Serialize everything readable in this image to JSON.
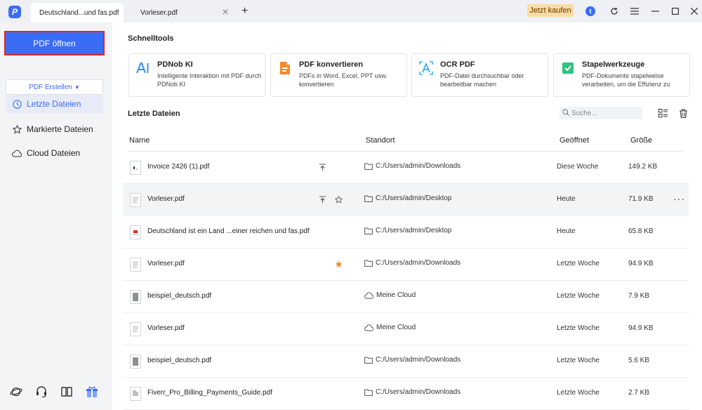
{
  "tabs": [
    {
      "title": "Deutschland...und fas.pdf",
      "active": true
    },
    {
      "title": "Vorleser.pdf",
      "active": false
    }
  ],
  "titlebar": {
    "buy_label": "Jetzt kaufen"
  },
  "sidebar": {
    "open_label": "PDF öffnen",
    "create_label": "PDF Erstellen",
    "nav": [
      {
        "label": "Letzte Dateien",
        "icon": "clock-icon",
        "active": true
      },
      {
        "label": "Markierte Dateien",
        "icon": "star-icon",
        "active": false
      },
      {
        "label": "Cloud Dateien",
        "icon": "cloud-icon",
        "active": false
      }
    ],
    "bottom_icons": [
      "planet-icon",
      "headset-icon",
      "book-icon",
      "gift-icon"
    ]
  },
  "quicktools": {
    "title": "Schnelltools",
    "cards": [
      {
        "title": "PDNob KI",
        "desc": "Intelligente Interaktion mit PDF durch PDNob KI",
        "icon": "ai-icon"
      },
      {
        "title": "PDF konvertieren",
        "desc": "PDFs in Word, Excel, PPT usw. konvertieren",
        "icon": "convert-icon"
      },
      {
        "title": "OCR PDF",
        "desc": "PDF-Datei durchsuchbar oder bearbeitbar machen",
        "icon": "ocr-icon"
      },
      {
        "title": "Stapelwerkzeuge",
        "desc": "PDF-Dokumente stapelweise verarbeiten, um die Effizienz zu",
        "icon": "batch-icon"
      }
    ]
  },
  "recent": {
    "title": "Letzte Dateien",
    "search_placeholder": "Suche...",
    "columns": {
      "name": "Name",
      "location": "Standort",
      "opened": "Geöffnet",
      "size": "Größe"
    },
    "files": [
      {
        "name": "Invoice 2426 (1).pdf",
        "location": "C:/Users/admin/Downloads",
        "loc_type": "folder",
        "opened": "Diese Woche",
        "size": "149.2 KB",
        "pinned": true,
        "starred": false,
        "hover": false
      },
      {
        "name": "Vorleser.pdf",
        "location": "C:/Users/admin/Desktop",
        "loc_type": "folder",
        "opened": "Heute",
        "size": "71.9 KB",
        "pinned": true,
        "starred": false,
        "hover": true
      },
      {
        "name": "Deutschland ist ein Land ...einer reichen und fas.pdf",
        "location": "C:/Users/admin/Desktop",
        "loc_type": "folder",
        "opened": "Heute",
        "size": "65.8 KB",
        "pinned": false,
        "starred": false,
        "hover": false
      },
      {
        "name": "Vorleser.pdf",
        "location": "C:/Users/admin/Downloads",
        "loc_type": "folder",
        "opened": "Letzte Woche",
        "size": "94.9 KB",
        "pinned": false,
        "starred": true,
        "hover": false
      },
      {
        "name": "beispiel_deutsch.pdf",
        "location": "Meine Cloud",
        "loc_type": "cloud",
        "opened": "Letzte Woche",
        "size": "7.9 KB",
        "pinned": false,
        "starred": false,
        "hover": false
      },
      {
        "name": "Vorleser.pdf",
        "location": "Meine Cloud",
        "loc_type": "cloud",
        "opened": "Letzte Woche",
        "size": "94.9 KB",
        "pinned": false,
        "starred": false,
        "hover": false
      },
      {
        "name": "beispiel_deutsch.pdf",
        "location": "C:/Users/admin/Downloads",
        "loc_type": "folder",
        "opened": "Letzte Woche",
        "size": "5.6 KB",
        "pinned": false,
        "starred": false,
        "hover": false
      },
      {
        "name": "Fiverr_Pro_Billing_Payments_Guide.pdf",
        "location": "C:/Users/admin/Downloads",
        "loc_type": "folder",
        "opened": "Letzte Woche",
        "size": "2.7 KB",
        "pinned": false,
        "starred": false,
        "hover": false
      }
    ]
  },
  "colors": {
    "accent": "#3b6cf6",
    "highlight_border": "#e02424",
    "star": "#f08a24",
    "buy_bg": "#f9dca3"
  }
}
